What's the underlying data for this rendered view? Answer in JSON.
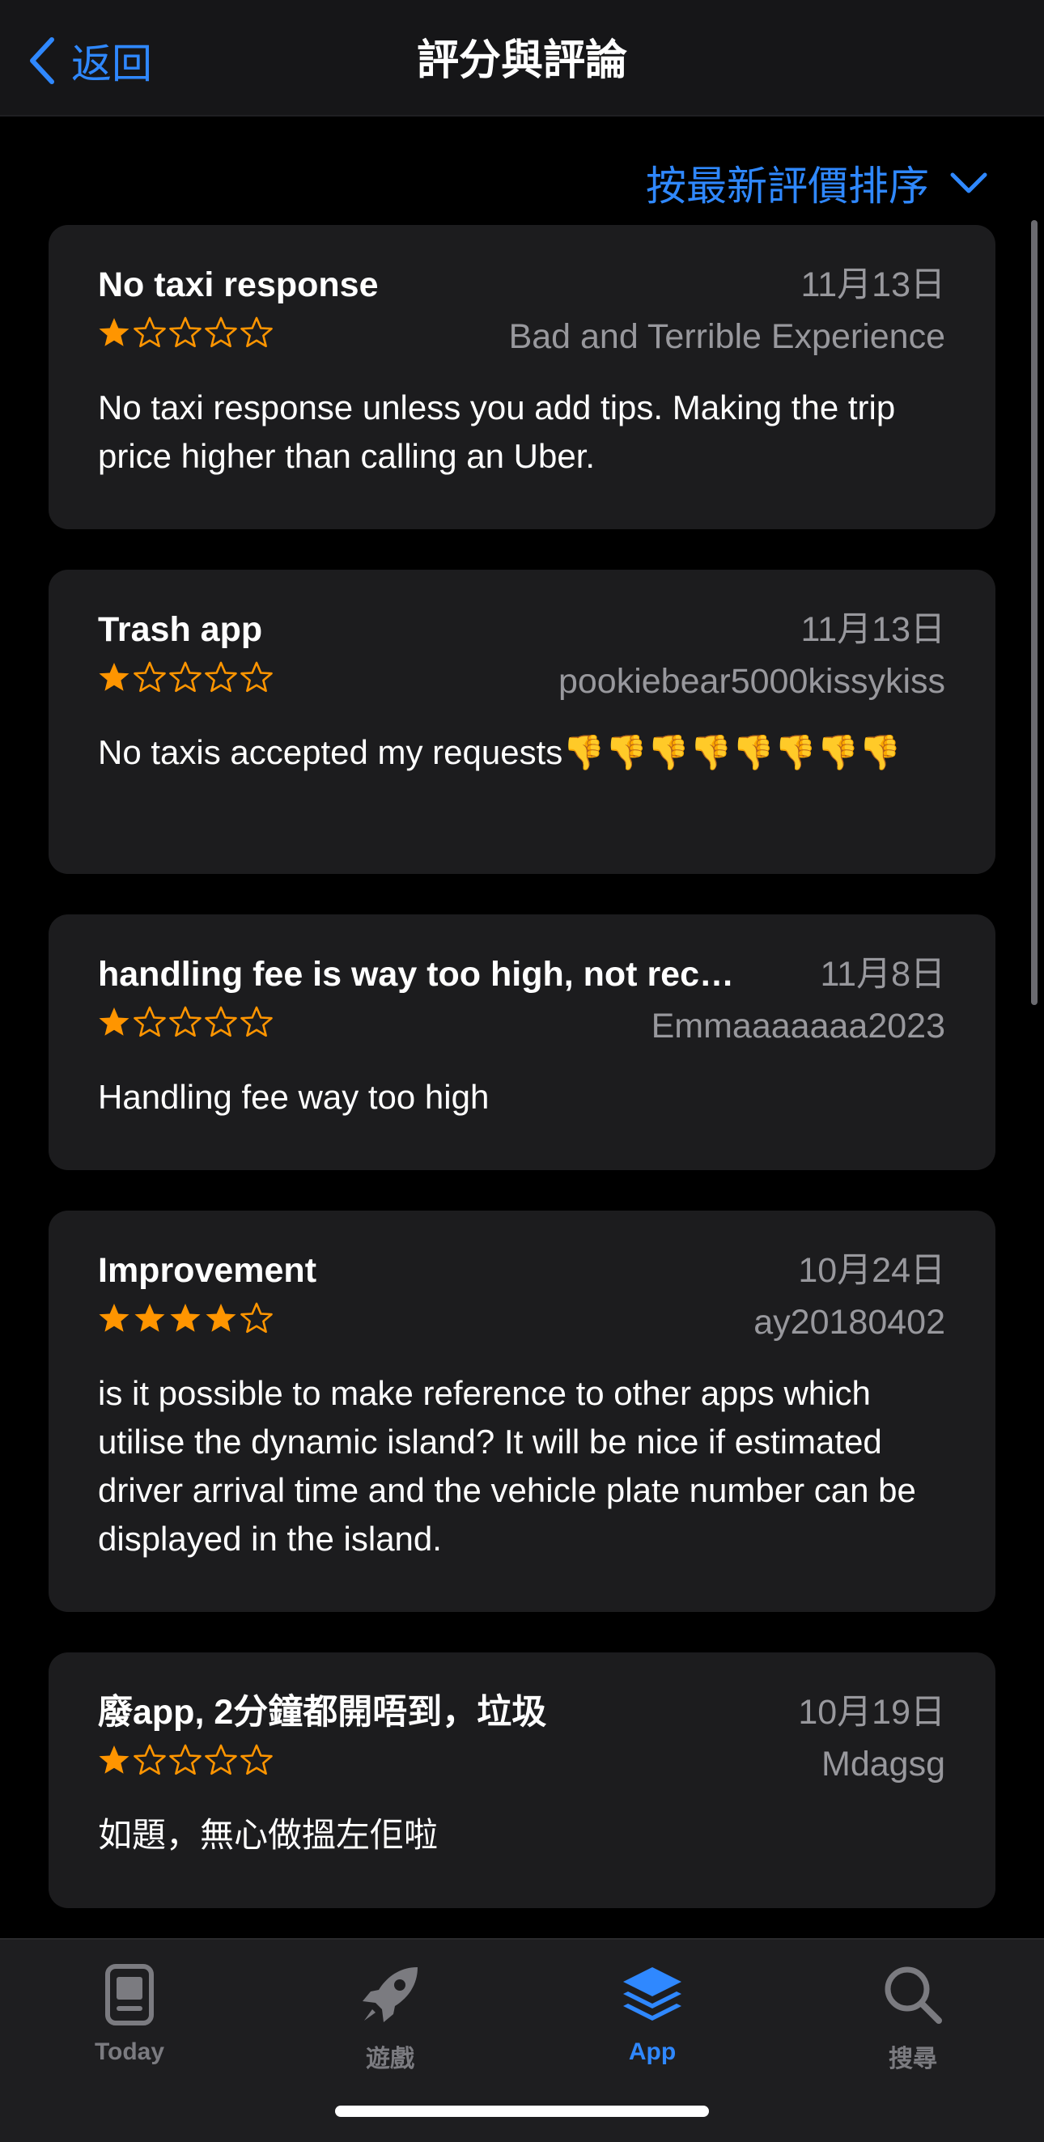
{
  "nav": {
    "back_label": "返回",
    "title": "評分與評論"
  },
  "sort": {
    "label": "按最新評價排序"
  },
  "colors": {
    "accent": "#2f88ff",
    "star": "#ff9500",
    "card": "#1c1c1e"
  },
  "reviews": [
    {
      "title": "No taxi response",
      "date": "11月13日",
      "rating": 1,
      "author": "Bad and Terrible Experience",
      "body": "No taxi response unless you add tips.  Making the trip price higher than calling an Uber."
    },
    {
      "title": "Trash app",
      "date": "11月13日",
      "rating": 1,
      "author": "pookiebear5000kissykiss",
      "body": "No taxis accepted my requests👎👎👎👎👎👎👎👎"
    },
    {
      "title": "handling fee is way too high, not reco...",
      "date": "11月8日",
      "rating": 1,
      "author": "Emmaaaaaaa2023",
      "body": "Handling fee way too high"
    },
    {
      "title": "Improvement",
      "date": "10月24日",
      "rating": 4,
      "author": "ay20180402",
      "body": "is it possible to make reference to other apps which utilise the dynamic island? It will be nice if estimated driver arrival time and the vehicle plate number can be displayed in the island."
    },
    {
      "title": "廢app, 2分鐘都開唔到，垃圾",
      "date": "10月19日",
      "rating": 1,
      "author": "Mdagsg",
      "body": "如題，無心做搵左佢啦"
    }
  ],
  "tabs": [
    {
      "label": "Today",
      "icon": "today-icon",
      "active": false
    },
    {
      "label": "遊戲",
      "icon": "rocket-icon",
      "active": false
    },
    {
      "label": "App",
      "icon": "apps-stack-icon",
      "active": true
    },
    {
      "label": "搜尋",
      "icon": "search-icon",
      "active": false
    }
  ]
}
